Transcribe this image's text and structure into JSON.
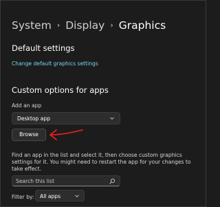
{
  "breadcrumb": {
    "items": [
      "System",
      "Display",
      "Graphics"
    ],
    "separator": "›"
  },
  "default_settings": {
    "title": "Default settings",
    "link": "Change default graphics settings"
  },
  "custom_options": {
    "title": "Custom options for apps",
    "add_app_label": "Add an app",
    "app_type_selected": "Desktop app",
    "browse_label": "Browse",
    "description": "Find an app in the list and select it, then choose custom graphics settings for it. You might need to restart the app for your changes to take effect.",
    "search_placeholder": "Search this list",
    "filter_label": "Filter by:",
    "filter_selected": "All apps"
  },
  "annotation": {
    "arrow_color": "#e02020"
  },
  "colors": {
    "background": "#1c1c1c",
    "link": "#7ad3f2",
    "control_bg": "#2d2d2d"
  },
  "icons": {
    "separator": "chevron-right-icon",
    "dropdown": "chevron-down-icon",
    "search": "search-icon"
  }
}
